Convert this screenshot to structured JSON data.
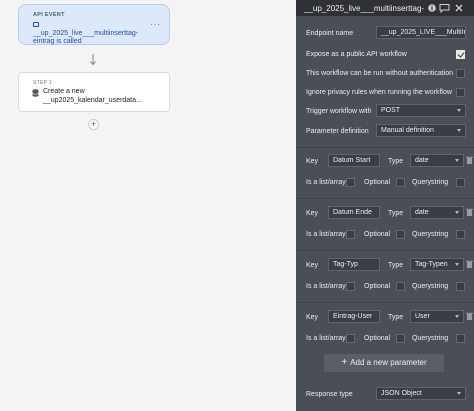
{
  "canvas": {
    "event": {
      "tag": "API EVENT",
      "title": "__up_2025_live___multiinserttag-eintrag is called",
      "menu": "···"
    },
    "step": {
      "tag": "STEP 1",
      "title": "Create a new __up2025_kalendar_userdata..."
    },
    "add_step": "+"
  },
  "panel": {
    "title": "__up_2025_live___multiinserttag-",
    "header_icons": [
      "info-icon",
      "comment-icon",
      "close-icon"
    ],
    "endpoint_label": "Endpoint name",
    "endpoint_value": "__up_2025_LIVE___MultiInser",
    "expose_label": "Expose as a public API workflow",
    "expose_checked": true,
    "no_auth_label": "This workflow can be run without authentication",
    "no_auth_checked": false,
    "privacy_label": "Ignore privacy rules when running the workflow",
    "privacy_checked": false,
    "trigger_label": "Trigger workflow with",
    "trigger_value": "POST",
    "param_def_label": "Parameter definition",
    "param_def_value": "Manual definition",
    "key_label": "Key",
    "type_label": "Type",
    "list_label": "Is a list/array",
    "optional_label": "Optional",
    "querystring_label": "Querystring",
    "params": [
      {
        "key": "Datum Start",
        "type": "date"
      },
      {
        "key": "Datum Ende",
        "type": "date"
      },
      {
        "key": "Tag-Typ",
        "type": "Tag-Typen"
      },
      {
        "key": "Eintrag-User",
        "type": "User"
      }
    ],
    "add_param_label": "Add a new parameter",
    "add_param_plus": "+",
    "response_label": "Response type",
    "response_value": "JSON Object"
  }
}
